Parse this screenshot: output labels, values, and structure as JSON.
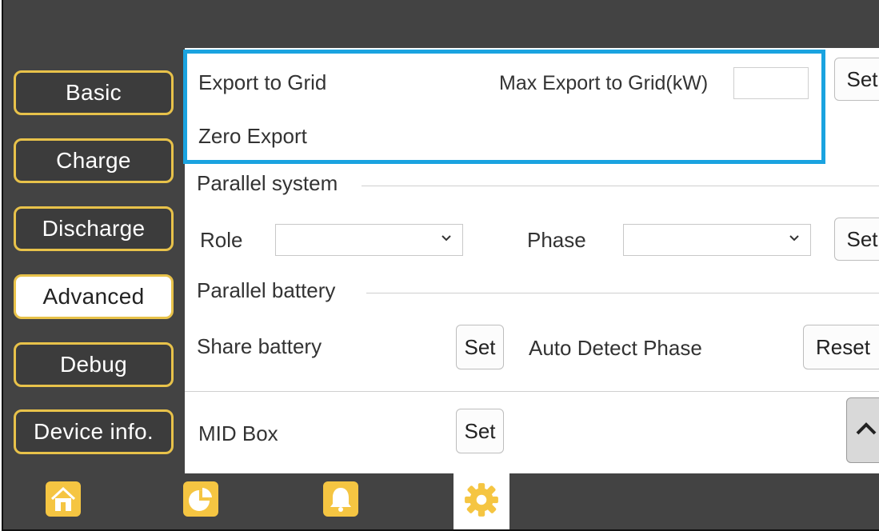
{
  "sidebar": {
    "items": [
      {
        "label": "Basic"
      },
      {
        "label": "Charge"
      },
      {
        "label": "Discharge"
      },
      {
        "label": "Advanced"
      },
      {
        "label": "Debug"
      },
      {
        "label": "Device info."
      }
    ],
    "active": "Advanced"
  },
  "export": {
    "export_to_grid": "Export to Grid",
    "max_export_label": "Max Export to Grid(kW)",
    "max_export_value": "",
    "set_label": "Set",
    "zero_export": "Zero Export"
  },
  "parallel_system": {
    "title": "Parallel system",
    "role_label": "Role",
    "role_value": "",
    "phase_label": "Phase",
    "phase_value": "",
    "set_label": "Set"
  },
  "parallel_battery": {
    "title": "Parallel battery",
    "share_battery_label": "Share battery",
    "share_set_label": "Set",
    "auto_detect_label": "Auto Detect Phase",
    "reset_label": "Reset"
  },
  "mid_box": {
    "label": "MID Box",
    "set_label": "Set"
  },
  "colors": {
    "accent": "#e8c24a",
    "highlight": "#1aa3e0",
    "background_dark": "#434343"
  },
  "nav": {
    "icons": [
      "home-icon",
      "pie-chart-icon",
      "bell-icon",
      "gear-icon"
    ],
    "active": "gear-icon"
  }
}
